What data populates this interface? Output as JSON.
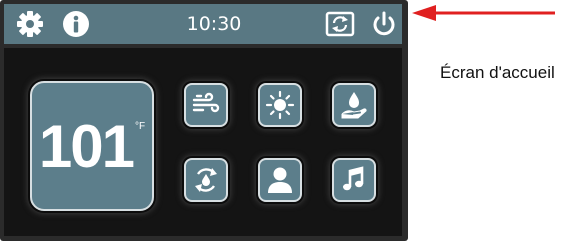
{
  "status_bar": {
    "time": "10:30",
    "icons": [
      "gear-icon",
      "info-icon",
      "refresh-icon",
      "power-icon"
    ]
  },
  "main": {
    "temperature": {
      "value": "101",
      "unit": "°F"
    },
    "tiles": [
      "wind-icon",
      "sun-icon",
      "water-drop-hand-icon",
      "cycle-drop-icon",
      "user-icon",
      "music-icon"
    ]
  },
  "annotation": {
    "label": "Écran d'accueil",
    "arrow_color": "#e02020"
  },
  "colors": {
    "bar": "#597883",
    "tile": "#5c7e8b",
    "background": "#141414"
  }
}
